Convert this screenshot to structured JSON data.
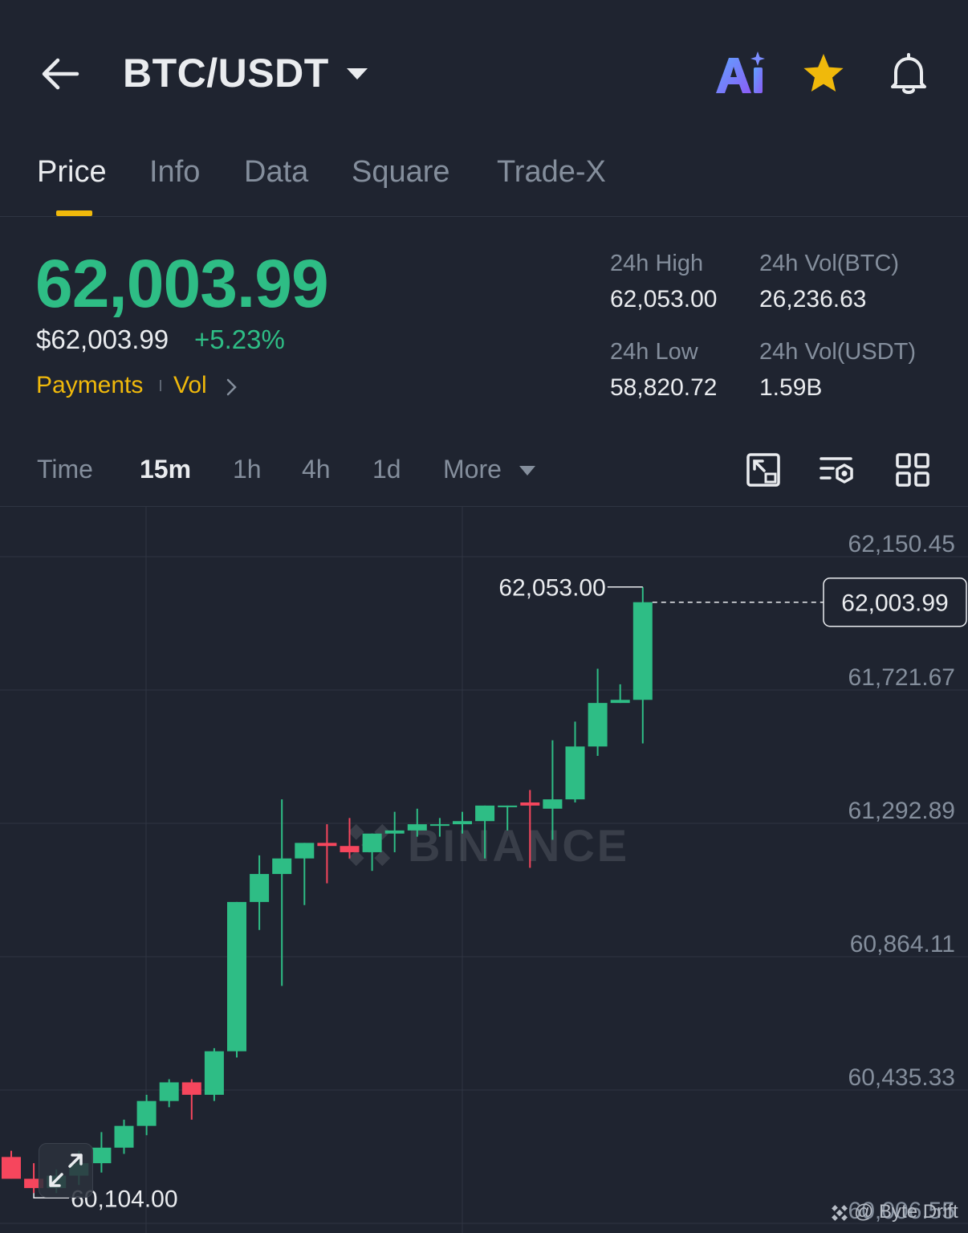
{
  "header": {
    "title": "BTC/USDT",
    "icons": [
      "back-arrow-icon",
      "caret-down-icon",
      "ai-assistant-icon",
      "star-icon",
      "bell-icon"
    ],
    "favorite_color": "#f0b90b"
  },
  "tabs": [
    {
      "label": "Price",
      "active": true
    },
    {
      "label": "Info",
      "active": false
    },
    {
      "label": "Data",
      "active": false
    },
    {
      "label": "Square",
      "active": false
    },
    {
      "label": "Trade-X",
      "active": false
    }
  ],
  "price": {
    "last": "62,003.99",
    "usd": "$62,003.99",
    "change": "+5.23%",
    "links": {
      "payments": "Payments",
      "vol": "Vol"
    }
  },
  "stats": {
    "high_label": "24h High",
    "high_value": "62,053.00",
    "vol_btc_label": "24h Vol(BTC)",
    "vol_btc_value": "26,236.63",
    "low_label": "24h Low",
    "low_value": "58,820.72",
    "vol_usdt_label": "24h Vol(USDT)",
    "vol_usdt_value": "1.59B"
  },
  "intervals": {
    "time": "Time",
    "items": [
      "15m",
      "1h",
      "4h",
      "1d"
    ],
    "active": "15m",
    "more": "More",
    "tools": [
      "chart-fullscreen-icon",
      "indicator-settings-icon",
      "layout-grid-icon"
    ]
  },
  "colors": {
    "up": "#2ebd85",
    "down": "#f6465d",
    "accent": "#f0b90b",
    "background": "#1f2430"
  },
  "chart_data": {
    "type": "candlestick",
    "interval": "15m",
    "y_ticks": [
      "62,150.45",
      "61,721.67",
      "61,292.89",
      "60,864.11",
      "60,435.33",
      "60,006.55"
    ],
    "ylim": [
      60006.55,
      62150.45
    ],
    "grid": true,
    "last_price": "62,003.99",
    "max_label": "62,053.00",
    "min_label": "60,104.00",
    "watermark": "BINANCE",
    "candles": [
      {
        "o": 60220,
        "h": 60240,
        "l": 60150,
        "c": 60150
      },
      {
        "o": 60150,
        "h": 60200,
        "l": 60104,
        "c": 60120
      },
      {
        "o": 60120,
        "h": 60180,
        "l": 60104,
        "c": 60160
      },
      {
        "o": 60160,
        "h": 60240,
        "l": 60130,
        "c": 60200
      },
      {
        "o": 60200,
        "h": 60300,
        "l": 60170,
        "c": 60250
      },
      {
        "o": 60250,
        "h": 60340,
        "l": 60230,
        "c": 60320
      },
      {
        "o": 60320,
        "h": 60420,
        "l": 60290,
        "c": 60400
      },
      {
        "o": 60400,
        "h": 60470,
        "l": 60380,
        "c": 60460
      },
      {
        "o": 60460,
        "h": 60470,
        "l": 60340,
        "c": 60420
      },
      {
        "o": 60420,
        "h": 60570,
        "l": 60400,
        "c": 60560
      },
      {
        "o": 60560,
        "h": 61040,
        "l": 60540,
        "c": 61040
      },
      {
        "o": 61040,
        "h": 61190,
        "l": 60950,
        "c": 61130
      },
      {
        "o": 61130,
        "h": 61370,
        "l": 60770,
        "c": 61180
      },
      {
        "o": 61180,
        "h": 61230,
        "l": 61030,
        "c": 61230
      },
      {
        "o": 61230,
        "h": 61290,
        "l": 61100,
        "c": 61220
      },
      {
        "o": 61220,
        "h": 61310,
        "l": 61180,
        "c": 61200
      },
      {
        "o": 61200,
        "h": 61260,
        "l": 61140,
        "c": 61260
      },
      {
        "o": 61260,
        "h": 61330,
        "l": 61200,
        "c": 61270
      },
      {
        "o": 61270,
        "h": 61340,
        "l": 61250,
        "c": 61290
      },
      {
        "o": 61290,
        "h": 61310,
        "l": 61250,
        "c": 61290
      },
      {
        "o": 61290,
        "h": 61330,
        "l": 61260,
        "c": 61300
      },
      {
        "o": 61300,
        "h": 61350,
        "l": 61180,
        "c": 61350
      },
      {
        "o": 61350,
        "h": 61350,
        "l": 61270,
        "c": 61350
      },
      {
        "o": 61360,
        "h": 61400,
        "l": 61150,
        "c": 61350
      },
      {
        "o": 61340,
        "h": 61560,
        "l": 61240,
        "c": 61370
      },
      {
        "o": 61370,
        "h": 61620,
        "l": 61360,
        "c": 61540
      },
      {
        "o": 61540,
        "h": 61790,
        "l": 61510,
        "c": 61680
      },
      {
        "o": 61680,
        "h": 61740,
        "l": 61680,
        "c": 61690
      },
      {
        "o": 61690,
        "h": 62053,
        "l": 61550,
        "c": 62003.99
      }
    ]
  },
  "footer": {
    "credit": "@ Byte Drift"
  }
}
